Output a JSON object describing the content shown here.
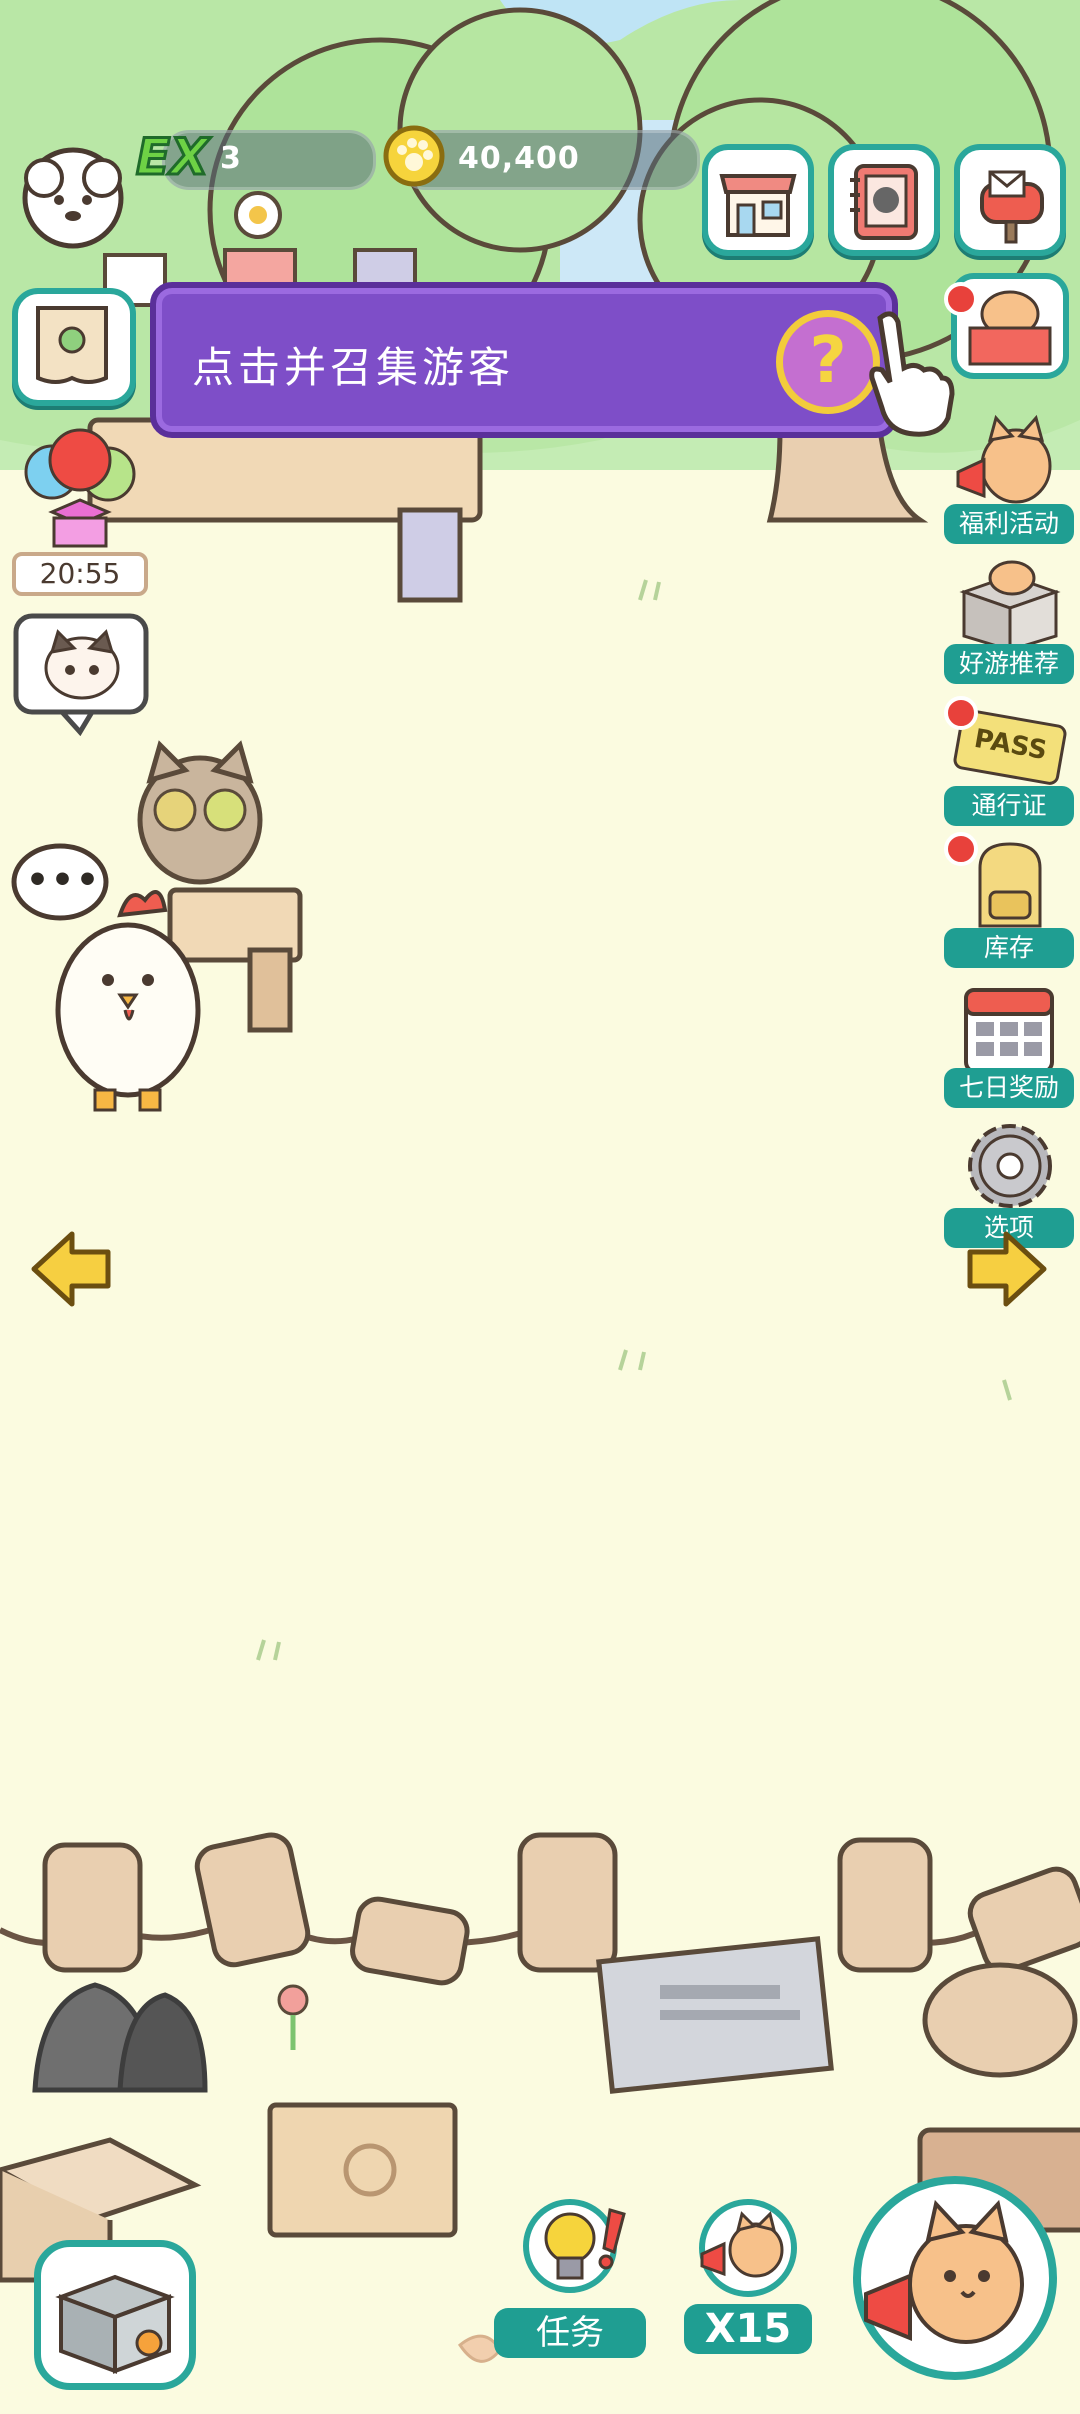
{
  "hud": {
    "level_badge": "EX",
    "level_value": "3",
    "coins_value": "40,400"
  },
  "tutorial": {
    "text": "点击并召集游客",
    "help_symbol": "?"
  },
  "left_panel": {
    "timer": "20:55"
  },
  "side_menu": {
    "welfare_label": "福利活动",
    "recommend_label": "好游推荐",
    "pass_label": "通行证",
    "pass_ticket_text": "PASS",
    "inventory_label": "库存",
    "seven_day_label": "七日奖励",
    "options_label": "选项"
  },
  "speech_bubble": "•••",
  "bottom_bar": {
    "tasks_label": "任务",
    "multiplier_label": "X15"
  },
  "colors": {
    "accent_teal": "#1f9e92",
    "banner_purple": "#7e4ec8",
    "ground": "#fbfbe0",
    "red_dot": "#e8413b"
  }
}
